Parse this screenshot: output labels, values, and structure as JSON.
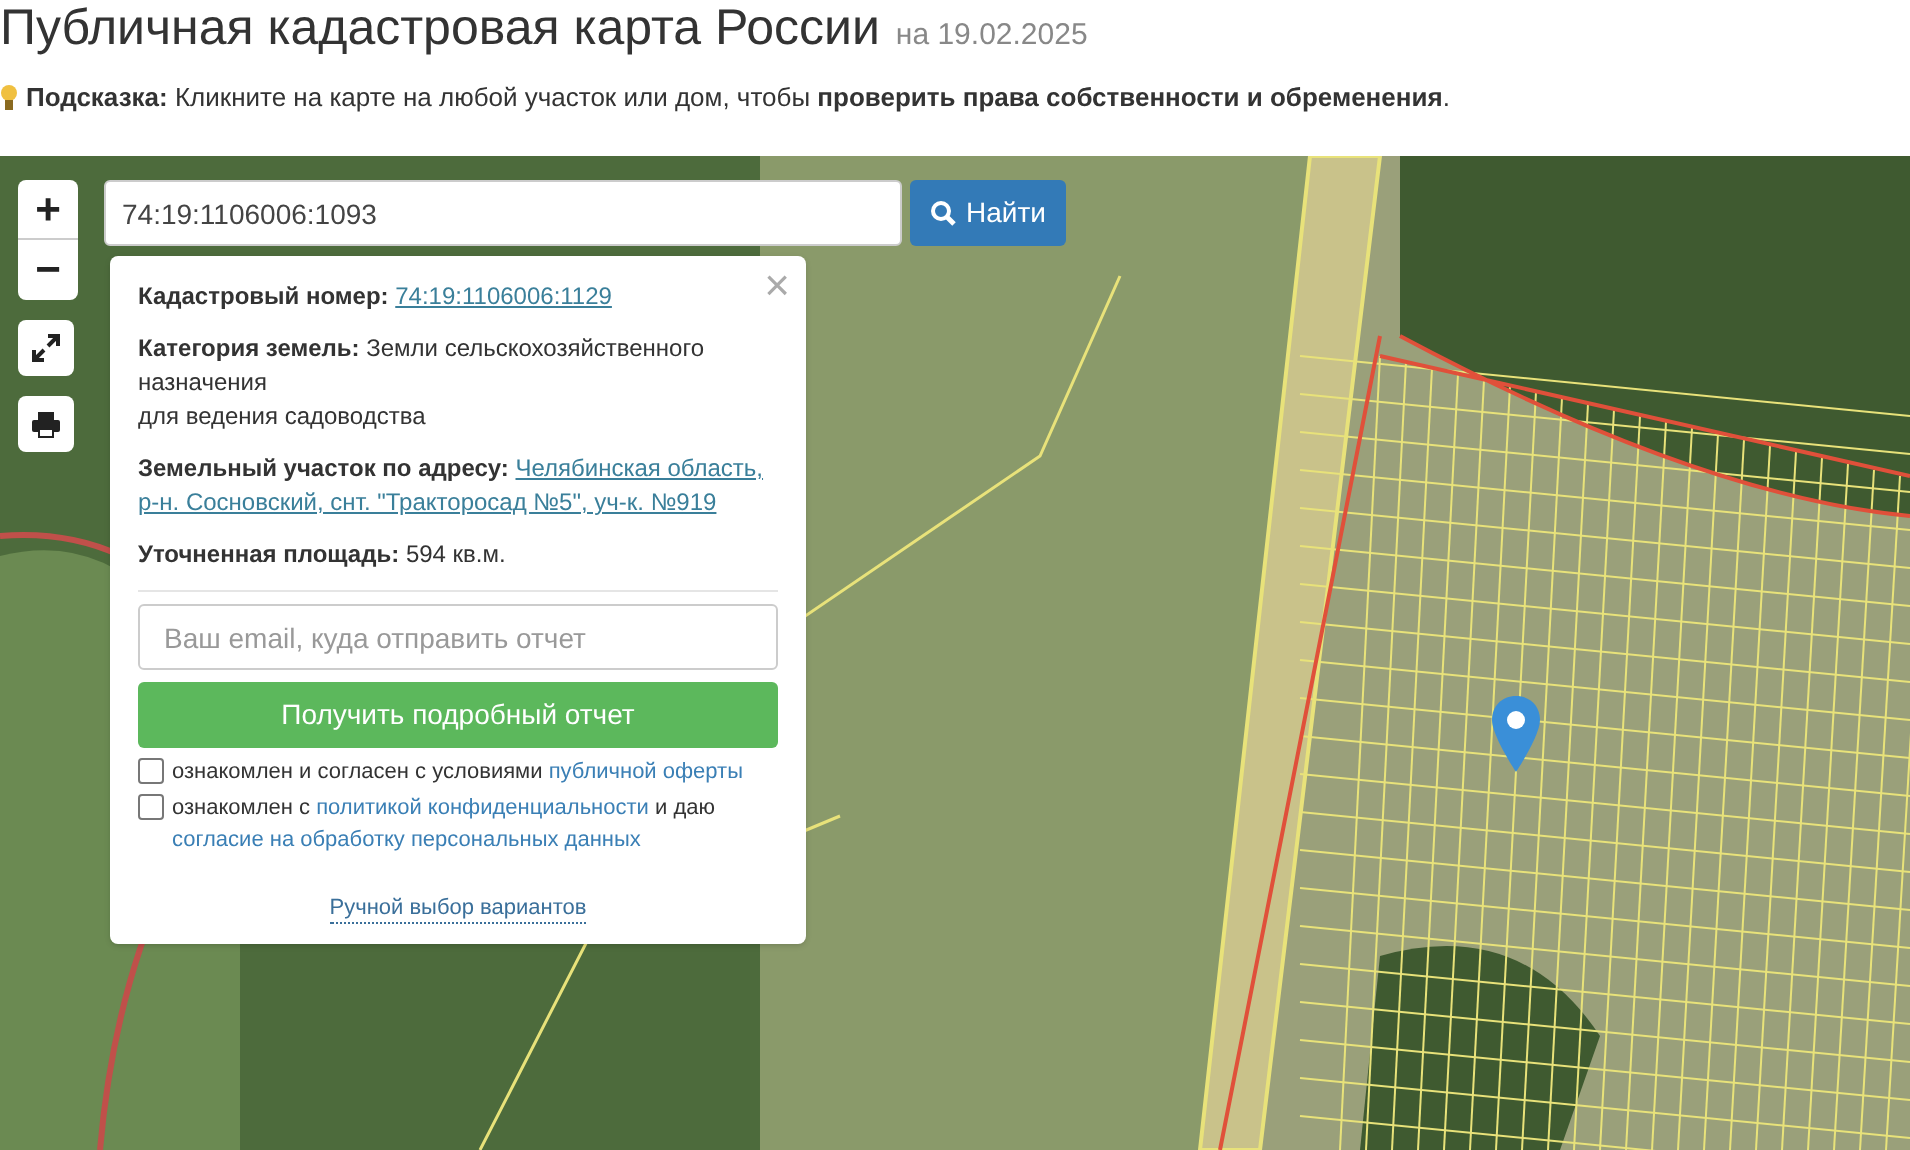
{
  "header": {
    "title": "Публичная кадастровая карта России",
    "date": "на 19.02.2025",
    "hint": "**Подсказка:** Кликните на карте на любой участок или дом, чтобы **проверить права собственности и обременения**."
  },
  "map_controls": {
    "zoom_in": "+",
    "zoom_out": "−"
  },
  "search": {
    "value": "74:19:1106006:1093",
    "button": "Найти"
  },
  "popup": {
    "close": "×",
    "fields": [
      {
        "kind": "link",
        "label": "Кадастровый номер:",
        "lines": [
          "74:19:1106006:1129"
        ]
      },
      {
        "kind": "text",
        "label": "Категория земель:",
        "lines": [
          "Земли сельскохозяйственного назначения",
          "для ведения садоводства"
        ]
      },
      {
        "kind": "link",
        "label": "Земельный участок по адресу:",
        "lines": [
          "Челябинская область,",
          "р-н. Сосновский, снт. \"Тракторосад №5\", уч-к. №919"
        ]
      },
      {
        "kind": "text",
        "label": "Уточненная площадь:",
        "lines": [
          "594 кв.м."
        ]
      }
    ],
    "email": {
      "placeholder": "Ваш email, куда отправить отчет"
    },
    "submit": "Получить подробный отчет",
    "consents": [
      {
        "checked": false,
        "parts": [
          {
            "kind": "text",
            "text": "ознакомлен и согласен с условиями "
          },
          {
            "kind": "link",
            "text": "публичной оферты"
          }
        ]
      },
      {
        "checked": false,
        "parts": [
          {
            "kind": "text",
            "text": "ознакомлен с "
          },
          {
            "kind": "link",
            "text": "политикой конфиденциальности"
          },
          {
            "kind": "text",
            "text": " и даю "
          },
          {
            "kind": "link",
            "text": "согласие на обработку персональных данных"
          }
        ]
      }
    ],
    "manual": "Ручной выбор вариантов"
  }
}
